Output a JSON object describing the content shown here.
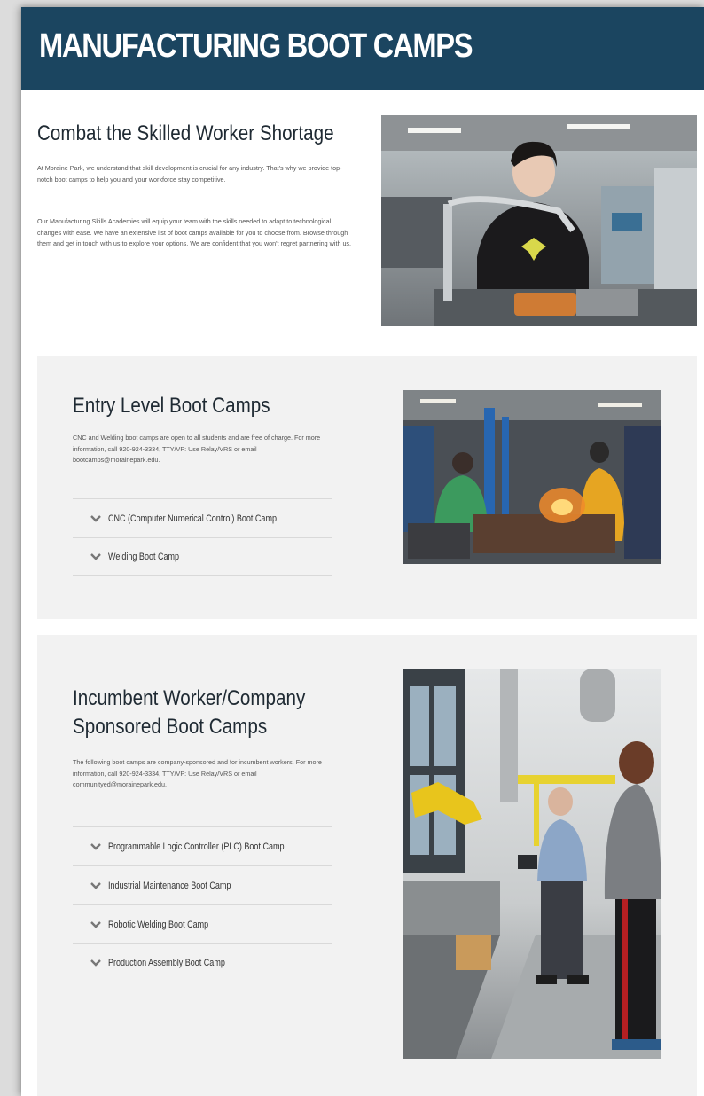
{
  "banner": {
    "title": "MANUFACTURING BOOT CAMPS"
  },
  "intro": {
    "heading": "Combat the Skilled Worker Shortage",
    "paragraph1": "At Moraine Park, we understand that skill development is crucial for any industry. That's why we provide top-notch boot camps to help you and your workforce stay competitive.",
    "paragraph2": "Our Manufacturing Skills Academies will equip your team with the skills needed to adapt to technological changes with ease. We have an extensive list of boot camps available for you to choose from. Browse through them and get in touch with us to explore your options. We are confident that you won't regret partnering with us."
  },
  "entry": {
    "heading": "Entry Level Boot Camps",
    "paragraph": "CNC and Welding boot camps are open to all students and are free of charge. For more information, call 920-924-3334, TTY/VP: Use Relay/VRS or email ",
    "email": "bootcamps@morainepark.edu",
    "paragraph_end": ".",
    "items": [
      "CNC (Computer Numerical Control) Boot Camp",
      "Welding Boot Camp"
    ]
  },
  "incumbent": {
    "heading": "Incumbent Worker/Company Sponsored Boot Camps",
    "paragraph": "The following boot camps are company-sponsored and for incumbent workers. For more information, call 920-924-3334, TTY/VP: Use Relay/VRS or email ",
    "email": "communityed@morainepark.edu",
    "paragraph_end": ".",
    "items": [
      "Programmable Logic Controller (PLC) Boot Camp",
      "Industrial Maintenance Boot Camp",
      "Robotic Welding Boot Camp",
      "Production Assembly Boot Camp"
    ]
  },
  "colors": {
    "banner": "#1b4560",
    "panel": "#f2f2f2",
    "heading": "#1f2a33",
    "chevron": "#777777"
  }
}
